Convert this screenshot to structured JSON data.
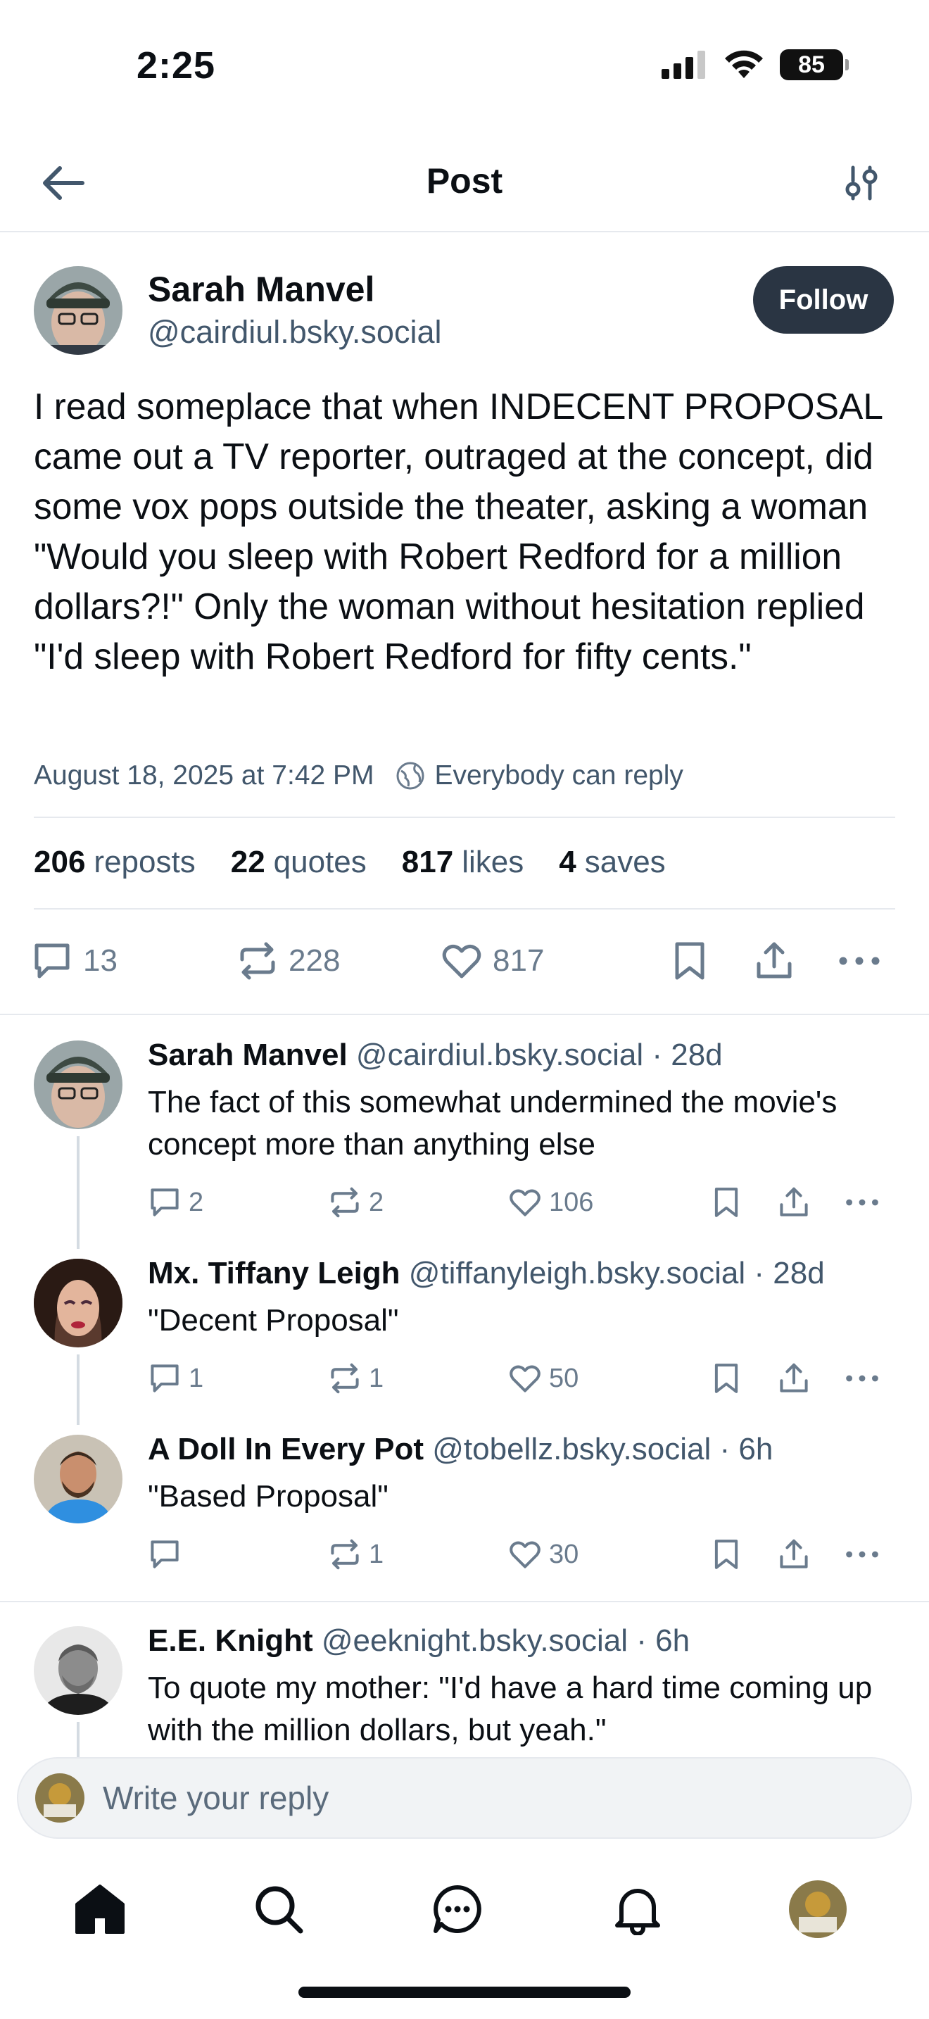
{
  "status_bar": {
    "time": "2:25",
    "battery": "85"
  },
  "header": {
    "title": "Post"
  },
  "post": {
    "author_name": "Sarah Manvel",
    "author_handle": "@cairdiul.bsky.social",
    "follow_label": "Follow",
    "text": "I read someplace that when INDECENT PROPOSAL came out a TV reporter, outraged at the concept, did some vox pops outside the theater, asking a woman \"Would you sleep with Robert Redford for a million dollars?!\" Only the woman without hesitation replied \"I'd sleep with Robert Redford for fifty cents.\"",
    "timestamp": "August 18, 2025 at 7:42 PM",
    "reply_setting": "Everybody can reply",
    "stats": {
      "reposts_num": "206",
      "reposts_label": "reposts",
      "quotes_num": "22",
      "quotes_label": "quotes",
      "likes_num": "817",
      "likes_label": "likes",
      "saves_num": "4",
      "saves_label": "saves"
    },
    "actions": {
      "replies": "13",
      "reposts": "228",
      "likes": "817"
    }
  },
  "replies": [
    {
      "name": "Sarah Manvel",
      "meta": " @cairdiul.bsky.social · 28d",
      "text": "The fact of this somewhat undermined the movie's concept more than anything else",
      "replies": "2",
      "reposts": "2",
      "likes": "106"
    },
    {
      "name": "Mx. Tiffany Leigh",
      "meta": " @tiffanyleigh.bsky.social · 28d",
      "text": "\"Decent Proposal\"",
      "replies": "1",
      "reposts": "1",
      "likes": "50"
    },
    {
      "name": "A Doll In Every Pot",
      "meta": " @tobellz.bsky.social · 6h",
      "text": "\"Based Proposal\"",
      "replies": "",
      "reposts": "1",
      "likes": "30"
    },
    {
      "name": "E.E. Knight",
      "meta": " @eeknight.bsky.social · 6h",
      "text": "To quote my mother: \"I'd have a hard time coming up with the million dollars, but yeah.\""
    }
  ],
  "compose": {
    "placeholder": "Write your reply"
  },
  "icons": {
    "back": "arrow-left-icon",
    "filter": "sliders-icon",
    "globe": "globe-icon",
    "reply": "speech-bubble-icon",
    "repost": "repost-icon",
    "like": "heart-icon",
    "bookmark": "bookmark-icon",
    "share": "share-icon",
    "more": "ellipsis-icon",
    "home": "home-icon",
    "search": "search-icon",
    "chat": "chat-icon",
    "bell": "bell-icon"
  },
  "colors": {
    "accent_dark": "#2a3543",
    "muted_text": "#42576c",
    "icon_gray": "#6a7b8d",
    "divider": "#e6e9ee"
  }
}
